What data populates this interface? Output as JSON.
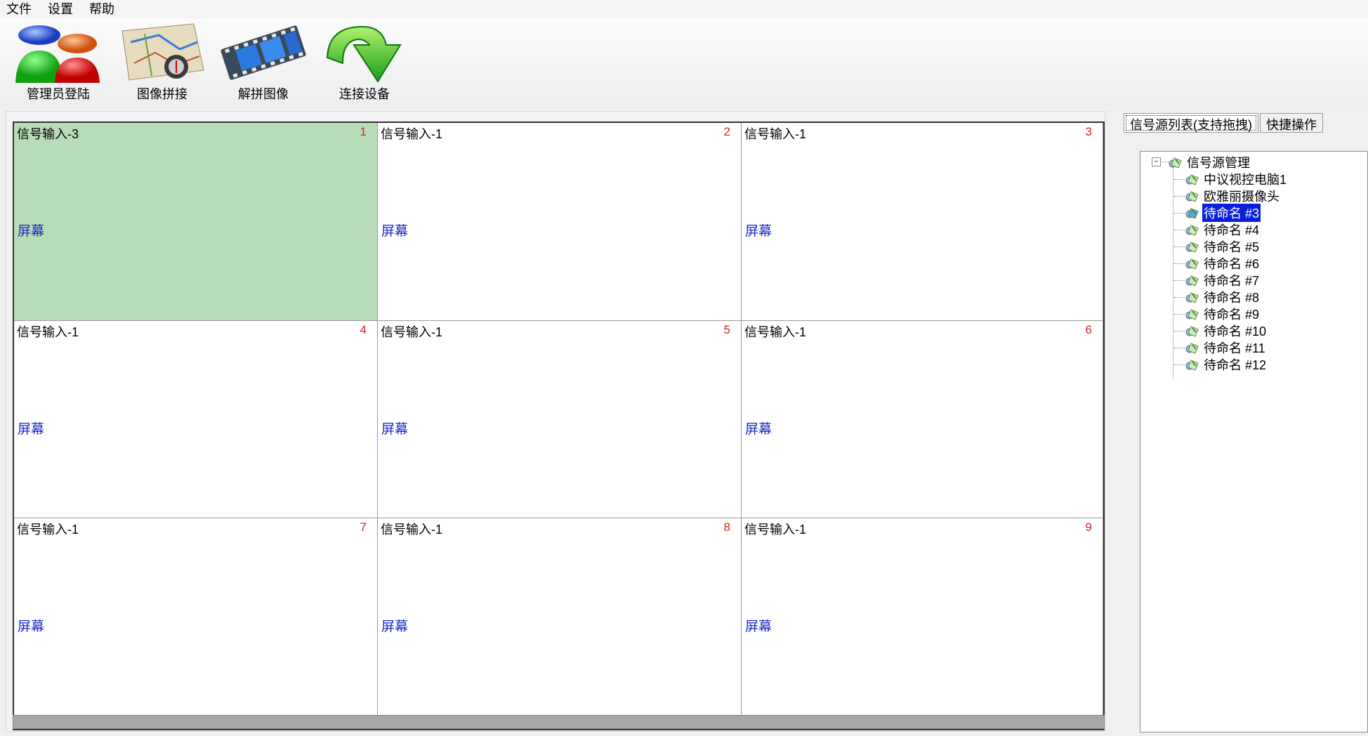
{
  "menu": [
    {
      "label": "文件"
    },
    {
      "label": "设置"
    },
    {
      "label": "帮助"
    }
  ],
  "toolbar": [
    {
      "label": "管理员登陆",
      "icon": "users-icon"
    },
    {
      "label": "图像拼接",
      "icon": "map-icon"
    },
    {
      "label": "解拼图像",
      "icon": "film-icon"
    },
    {
      "label": "连接设备",
      "icon": "green-arrow-icon"
    }
  ],
  "grid": {
    "screen_label": "屏幕",
    "selected_color": "#b8dcb8",
    "cells": [
      {
        "title": "信号输入-3",
        "num": "1",
        "selected": true
      },
      {
        "title": "信号输入-1",
        "num": "2",
        "selected": false
      },
      {
        "title": "信号输入-1",
        "num": "3",
        "selected": false
      },
      {
        "title": "信号输入-1",
        "num": "4",
        "selected": false
      },
      {
        "title": "信号输入-1",
        "num": "5",
        "selected": false
      },
      {
        "title": "信号输入-1",
        "num": "6",
        "selected": false
      },
      {
        "title": "信号输入-1",
        "num": "7",
        "selected": false
      },
      {
        "title": "信号输入-1",
        "num": "8",
        "selected": false
      },
      {
        "title": "信号输入-1",
        "num": "9",
        "selected": false
      }
    ]
  },
  "tabs": [
    {
      "label": "信号源列表(支持拖拽)",
      "active": true
    },
    {
      "label": "快捷操作",
      "active": false
    }
  ],
  "tree": {
    "root": "信号源管理",
    "items": [
      {
        "label": "中议视控电脑1",
        "selected": false
      },
      {
        "label": "欧雅丽摄像头",
        "selected": false
      },
      {
        "label": "待命名 #3",
        "selected": true
      },
      {
        "label": "待命名 #4",
        "selected": false
      },
      {
        "label": "待命名 #5",
        "selected": false
      },
      {
        "label": "待命名 #6",
        "selected": false
      },
      {
        "label": "待命名 #7",
        "selected": false
      },
      {
        "label": "待命名 #8",
        "selected": false
      },
      {
        "label": "待命名 #9",
        "selected": false
      },
      {
        "label": "待命名 #10",
        "selected": false
      },
      {
        "label": "待命名 #11",
        "selected": false
      },
      {
        "label": "待命名 #12",
        "selected": false
      }
    ]
  }
}
